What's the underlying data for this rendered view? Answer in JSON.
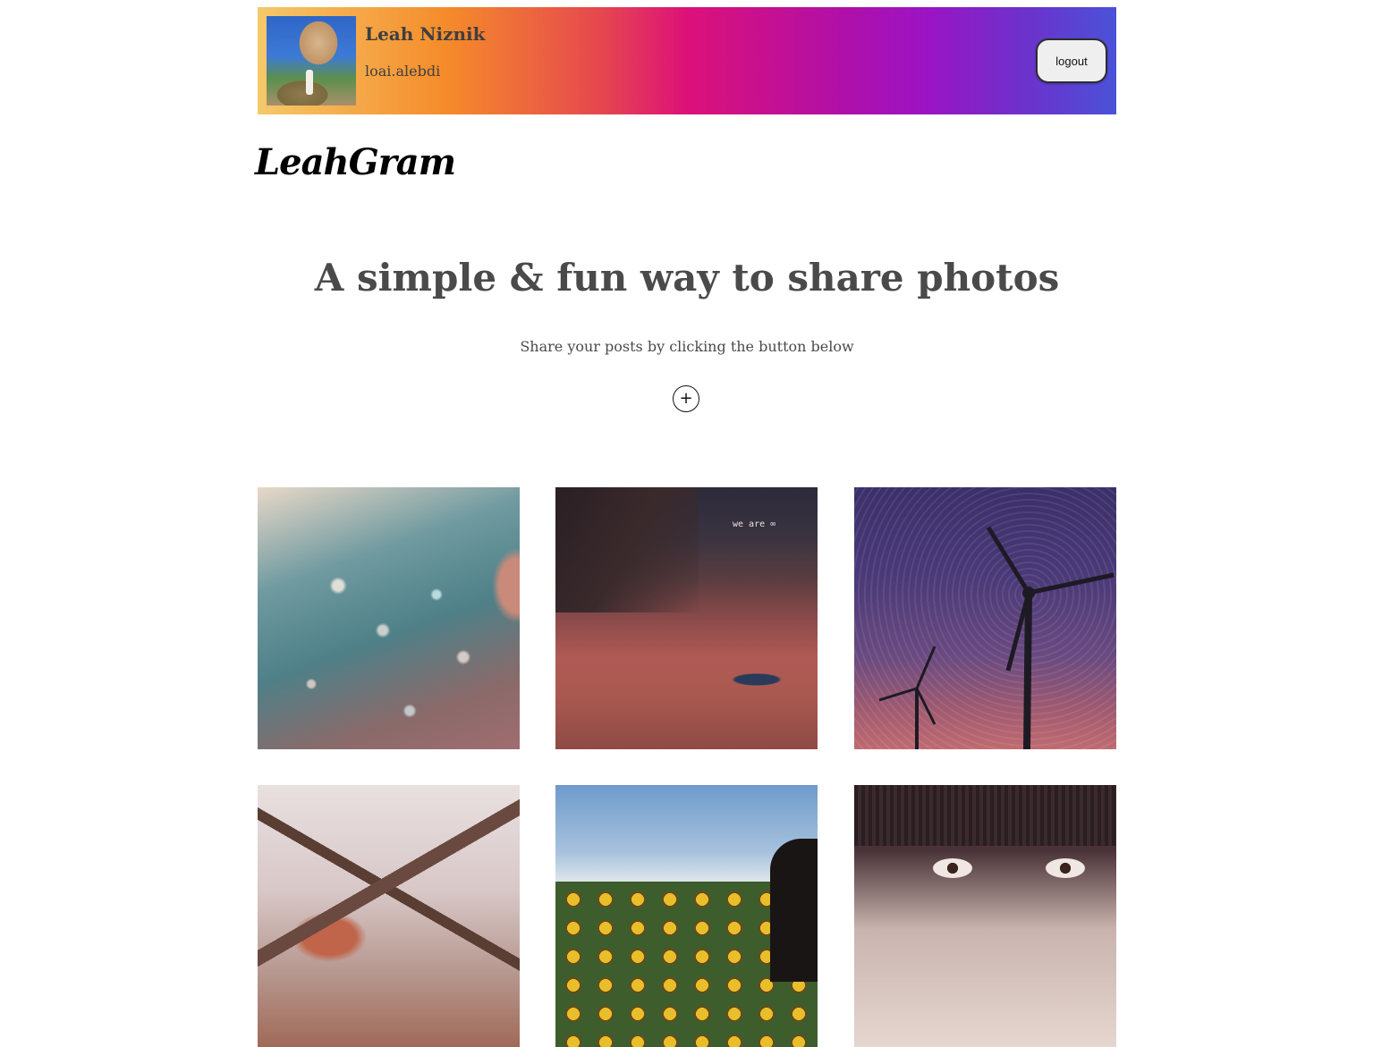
{
  "profile": {
    "name": "Leah Niznik",
    "username": "loai.alebdi",
    "logout_label": "logout"
  },
  "brand": {
    "logo": "LeahGram"
  },
  "hero": {
    "title": "A simple & fun way to share photos",
    "subtitle": "Share your posts by clicking the button below",
    "add_icon": "plus-icon",
    "add_glyph": "+"
  },
  "gallery": {
    "photos": [
      {
        "tag": ""
      },
      {
        "tag": "we are ∞"
      },
      {
        "tag": ""
      },
      {
        "tag": ""
      },
      {
        "tag": ""
      },
      {
        "tag": ""
      }
    ]
  },
  "colors": {
    "gradient": [
      "#f5c96a",
      "#f58b2a",
      "#dc1178",
      "#9b14c4",
      "#4b52d8"
    ],
    "text": "#4a4a4a"
  }
}
